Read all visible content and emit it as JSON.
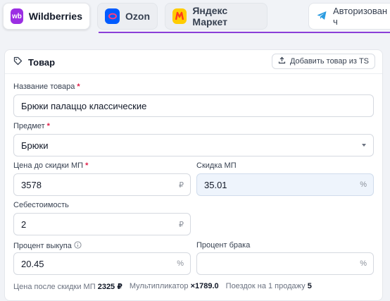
{
  "marketplace_tabs": [
    {
      "label": "Wildberries",
      "logo_text": "wb",
      "active": true
    },
    {
      "label": "Ozon",
      "logo_text": "",
      "active": false
    },
    {
      "label": "Яндекс Маркет",
      "logo_text": "",
      "active": false
    }
  ],
  "auth_status": "Авторизован ч",
  "card": {
    "title": "Товар",
    "add_button": "Добавить товар из TS"
  },
  "fields": {
    "name": {
      "label": "Название товара",
      "value": "Брюки палаццо классические"
    },
    "subject": {
      "label": "Предмет",
      "value": "Брюки"
    },
    "price": {
      "label": "Цена до скидки МП",
      "value": "3578",
      "suffix": "₽"
    },
    "discount": {
      "label": "Скидка МП",
      "value": "35.01",
      "suffix": "%"
    },
    "cost": {
      "label": "Себестоимость",
      "value": "2",
      "suffix": "₽"
    },
    "buyout": {
      "label": "Процент выкупа",
      "value": "20.45",
      "suffix": "%"
    },
    "defect": {
      "label": "Процент брака",
      "value": "",
      "suffix": "%"
    }
  },
  "summary": {
    "price_after_label": "Цена после скидки МП",
    "price_after_value": "2325 ₽",
    "multiplier_label": "Мультипликатор",
    "multiplier_value": "×1789.0",
    "trips_label": "Поездок на 1 продажу",
    "trips_value": "5"
  },
  "colors": {
    "accent": "#8b3fd8",
    "wb": "#9b2ee3",
    "ozon": "#005bff",
    "ym": "#ffcc00",
    "required": "#e11d48"
  }
}
